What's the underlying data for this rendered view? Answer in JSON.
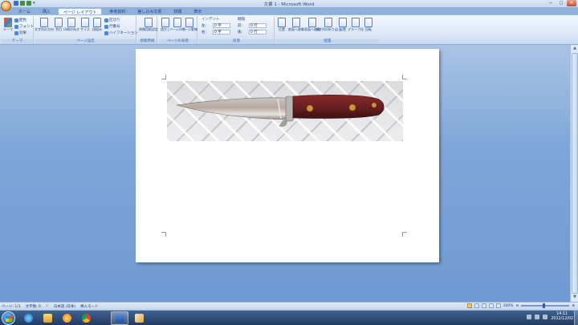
{
  "window": {
    "title": "文書 1 - Microsoft Word"
  },
  "qat": {
    "items": [
      "save-icon",
      "undo-icon",
      "redo-icon",
      "customize-icon"
    ],
    "dropdown": "▾"
  },
  "winctl": {
    "minimize": "─",
    "maximize": "□",
    "close": "✕"
  },
  "tabs": [
    "ホーム",
    "挿入",
    "ページ レイアウト",
    "参考資料",
    "差し込み文書",
    "校閲",
    "表示"
  ],
  "active_tab": "ページ レイアウト",
  "ribbon": {
    "theme_group": {
      "label": "テーマ",
      "big": "テーマ",
      "colors": "配色",
      "fonts": "フォント",
      "effects": "効果"
    },
    "page_setup": {
      "label": "ページ設定",
      "text_direction": "文字列の方向",
      "margins": "余白",
      "orientation": "印刷の向き",
      "size": "サイズ",
      "columns": "段組み",
      "breaks": "区切り",
      "line_numbers": "行番号",
      "hyphenation": "ハイフネーション"
    },
    "manuscript": {
      "label": "原稿用紙",
      "settings": "原稿用紙設定"
    },
    "background": {
      "label": "ページの背景",
      "watermark": "透かし",
      "page_color": "ページの色",
      "page_borders": "ページ罫線"
    },
    "paragraph": {
      "label": "段落",
      "indent_title": "インデント",
      "spacing_title": "間隔",
      "left": "左:",
      "right": "右:",
      "before": "前:",
      "after": "後:",
      "left_val": "0 字",
      "right_val": "0 字",
      "before_val": "0 行",
      "after_val": "0 行"
    },
    "arrange": {
      "label": "配置",
      "position": "位置",
      "bring_front": "前面へ移動",
      "send_back": "背面へ移動",
      "wrap": "文字列の折り返し",
      "align": "配置",
      "group": "グループ化",
      "rotate": "回転"
    }
  },
  "status": {
    "page": "ページ: 1/1",
    "words": "文字数: 0",
    "language": "日本語 (日本)",
    "mode": "挿入モード",
    "zoom": "100%"
  },
  "taskbar": {
    "time": "14:11",
    "date": "2012/12/02",
    "apps": [
      "ie-icon",
      "explorer-icon",
      "media-icon",
      "chrome-icon",
      "word-icon",
      "paint-icon"
    ],
    "active_app": "word-icon"
  }
}
